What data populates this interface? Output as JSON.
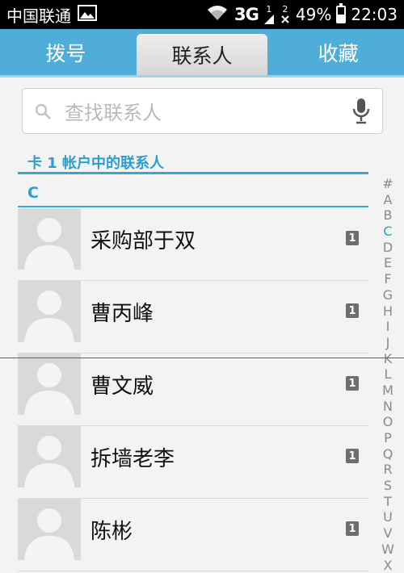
{
  "status_bar": {
    "carrier": "中国联通",
    "network": "3G",
    "sim1": "1",
    "sim2": "2",
    "battery_text": "49%",
    "battery_level": 0.49,
    "time": "22:03"
  },
  "tabs": [
    {
      "label": "拨号",
      "active": false
    },
    {
      "label": "联系人",
      "active": true
    },
    {
      "label": "收藏",
      "active": false
    }
  ],
  "search": {
    "placeholder": "查找联系人"
  },
  "sections": {
    "account": "卡 1 帐户中的联系人",
    "letter": "C"
  },
  "contacts": [
    {
      "name": "采购部于双",
      "badge": "1"
    },
    {
      "name": "曹丙峰",
      "badge": "1"
    },
    {
      "name": "曹文威",
      "badge": "1"
    },
    {
      "name": "拆墙老李",
      "badge": "1"
    },
    {
      "name": "陈彬",
      "badge": "1"
    }
  ],
  "index": [
    "#",
    "A",
    "B",
    "C",
    "D",
    "E",
    "F",
    "G",
    "H",
    "I",
    "J",
    "K",
    "L",
    "M",
    "N",
    "O",
    "P",
    "Q",
    "R",
    "S",
    "T",
    "U",
    "V",
    "W",
    "X"
  ],
  "index_active": "C",
  "colors": {
    "accent": "#4eaed9",
    "section": "#2d9dd0"
  }
}
